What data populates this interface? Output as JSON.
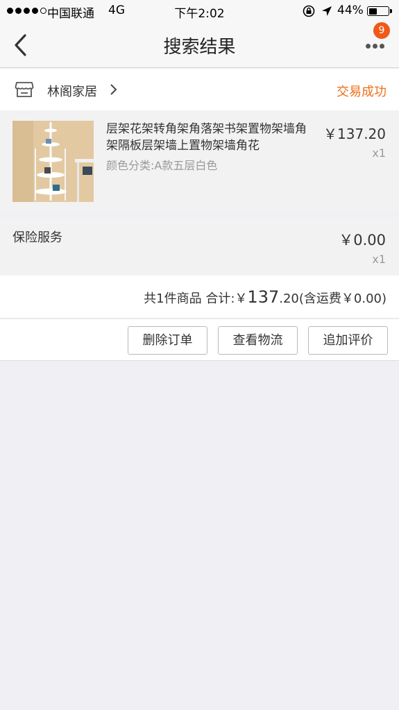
{
  "status_bar": {
    "carrier": "中国联通",
    "network": "4G",
    "time": "下午2:02",
    "battery_percent": "44%",
    "battery_level": 0.44,
    "signal_bars": 4
  },
  "nav": {
    "title": "搜索结果",
    "badge_count": "9"
  },
  "shop": {
    "name": "林阁家居",
    "status": "交易成功"
  },
  "product": {
    "title": "层架花架转角架角落架书架置物架墙角架隔板层架墙上置物架墙角花",
    "sku": "颜色分类:A款五层白色",
    "price": "￥137.20",
    "quantity": "x1"
  },
  "insurance": {
    "label": "保险服务",
    "price": "￥0.00",
    "quantity": "x1"
  },
  "total": {
    "count_text": "共1件商品 合计:",
    "currency": "￥",
    "amount_int": "137",
    "amount_dec": ".20",
    "shipping": "(含运费￥0.00)"
  },
  "actions": {
    "delete": "删除订单",
    "logistics": "查看物流",
    "review": "追加评价"
  },
  "colors": {
    "accent": "#ee6f1a",
    "badge": "#f05a18",
    "background": "#efeff4"
  }
}
